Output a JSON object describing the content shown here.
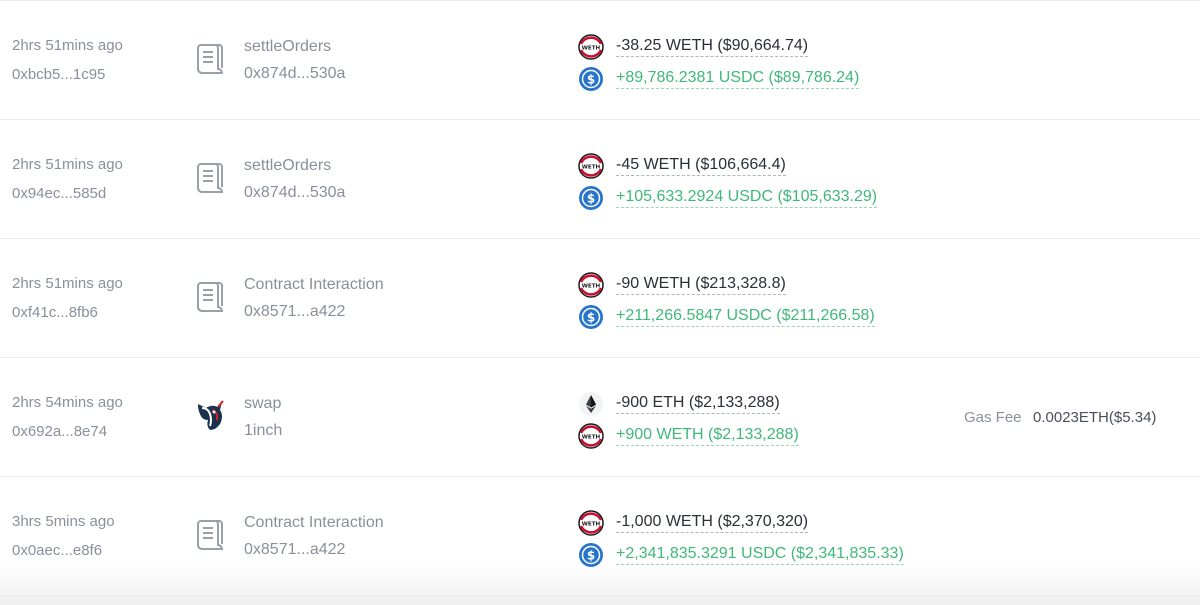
{
  "colors": {
    "muted_text": "#8a8f99",
    "negative_amount": "#2b2f36",
    "positive_amount": "#3fb87a",
    "usdc_blue": "#2775ca",
    "weth_red": "#c8102e"
  },
  "transactions": [
    {
      "time": "2hrs 51mins ago",
      "hash": "0xbcb5...1c95",
      "type_icon": "contract-icon",
      "method": "settleOrders",
      "address": "0x874d...530a",
      "token_out": {
        "icon": "weth-icon",
        "amount": "-38.25 WETH ($90,664.74)"
      },
      "token_in": {
        "icon": "usdc-icon",
        "amount": "+89,786.2381 USDC ($89,786.24)"
      }
    },
    {
      "time": "2hrs 51mins ago",
      "hash": "0x94ec...585d",
      "type_icon": "contract-icon",
      "method": "settleOrders",
      "address": "0x874d...530a",
      "token_out": {
        "icon": "weth-icon",
        "amount": "-45 WETH ($106,664.4)"
      },
      "token_in": {
        "icon": "usdc-icon",
        "amount": "+105,633.2924 USDC ($105,633.29)"
      }
    },
    {
      "time": "2hrs 51mins ago",
      "hash": "0xf41c...8fb6",
      "type_icon": "contract-icon",
      "method": "Contract Interaction",
      "address": "0x8571...a422",
      "token_out": {
        "icon": "weth-icon",
        "amount": "-90 WETH ($213,328.8)"
      },
      "token_in": {
        "icon": "usdc-icon",
        "amount": "+211,266.5847 USDC ($211,266.58)"
      }
    },
    {
      "time": "2hrs 54mins ago",
      "hash": "0x692a...8e74",
      "type_icon": "1inch-unicorn-icon",
      "method": "swap",
      "address": "1inch",
      "token_out": {
        "icon": "eth-icon",
        "amount": "-900 ETH ($2,133,288)"
      },
      "token_in": {
        "icon": "weth-icon",
        "amount": "+900 WETH ($2,133,288)"
      },
      "gas_label": "Gas Fee",
      "gas_value": "0.0023ETH($5.34)"
    },
    {
      "time": "3hrs 5mins ago",
      "hash": "0x0aec...e8f6",
      "type_icon": "contract-icon",
      "method": "Contract Interaction",
      "address": "0x8571...a422",
      "token_out": {
        "icon": "weth-icon",
        "amount": "-1,000 WETH ($2,370,320)"
      },
      "token_in": {
        "icon": "usdc-icon",
        "amount": "+2,341,835.3291 USDC ($2,341,835.33)"
      }
    }
  ]
}
